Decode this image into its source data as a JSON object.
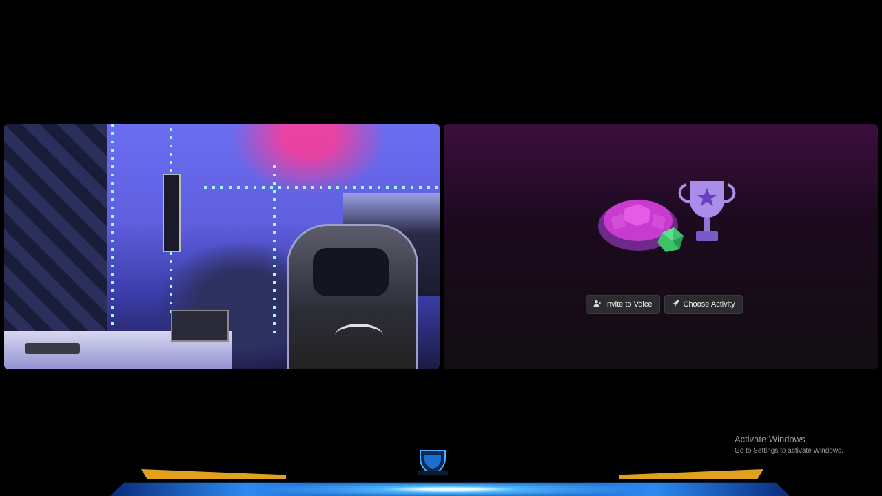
{
  "activity_panel": {
    "invite_label": "Invite to Voice",
    "choose_label": "Choose Activity",
    "icons": [
      "add-user-icon",
      "rocket-icon"
    ]
  },
  "watermark": {
    "title": "Activate Windows",
    "subtitle": "Go to Settings to activate Windows."
  },
  "colors": {
    "accent_gold": "#e0a21e",
    "activity_bg_top": "#3b0e3d",
    "button_bg": "#2b2b30"
  }
}
